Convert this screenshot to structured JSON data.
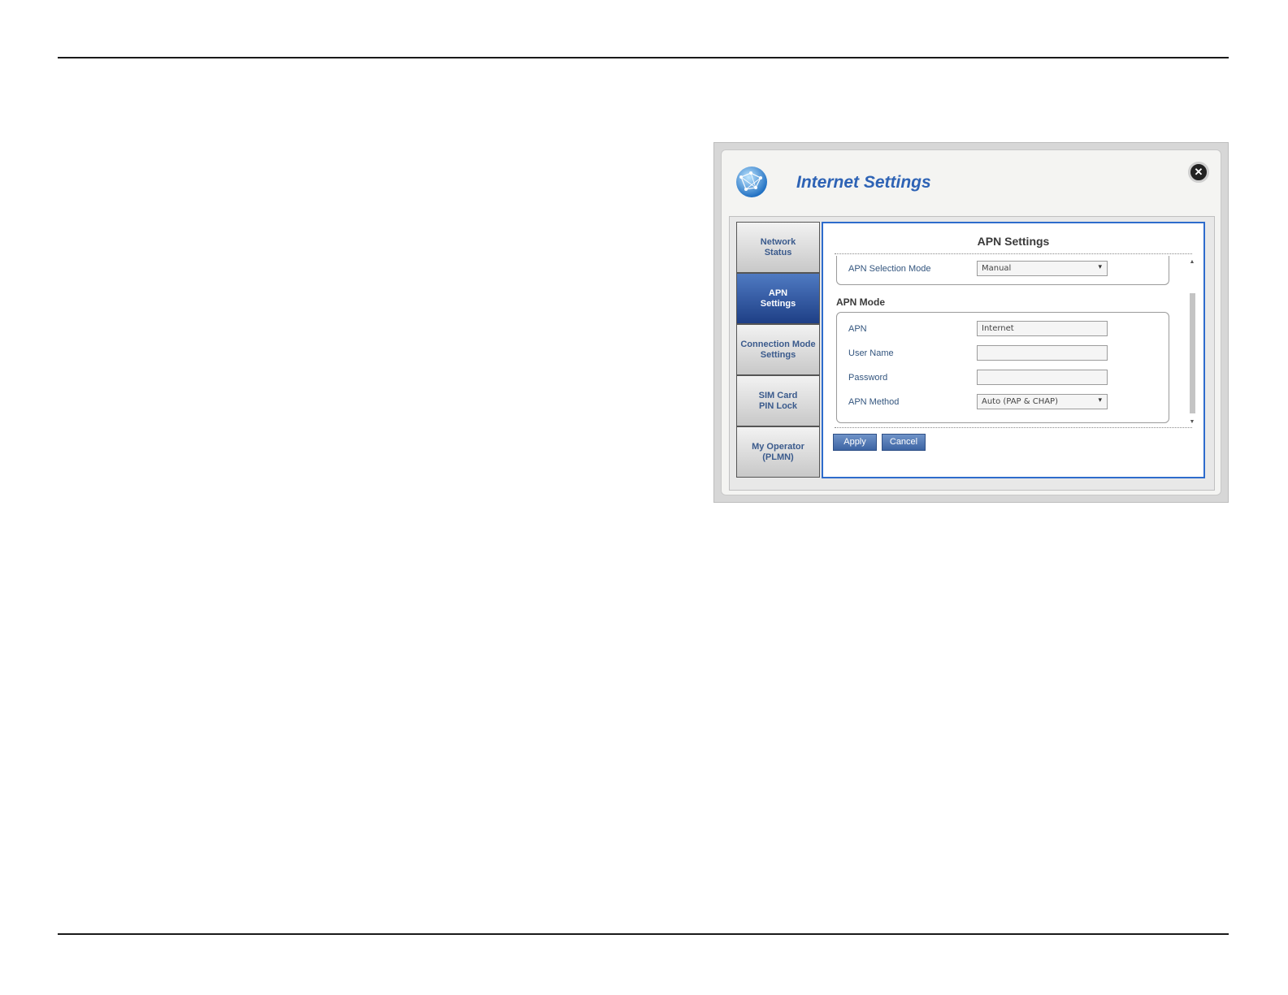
{
  "window": {
    "title": "Internet Settings"
  },
  "sidebar": {
    "items": [
      {
        "label": "Network\nStatus",
        "active": false
      },
      {
        "label": "APN\nSettings",
        "active": true
      },
      {
        "label": "Connection Mode\nSettings",
        "active": false
      },
      {
        "label": "SIM Card\nPIN Lock",
        "active": false
      },
      {
        "label": "My Operator\n(PLMN)",
        "active": false
      }
    ]
  },
  "panel": {
    "title": "APN Settings",
    "apn_selection_mode": {
      "label": "APN Selection Mode",
      "value": "Manual"
    },
    "apn_mode_heading": "APN Mode",
    "apn": {
      "label": "APN",
      "value": "Internet"
    },
    "username": {
      "label": "User Name",
      "value": ""
    },
    "password": {
      "label": "Password",
      "value": ""
    },
    "apn_method": {
      "label": "APN Method",
      "value": "Auto (PAP & CHAP)"
    },
    "apply_label": "Apply",
    "cancel_label": "Cancel"
  },
  "icons": {
    "close": "close-icon",
    "globe": "globe-icon"
  },
  "colors": {
    "accent": "#2e63b5",
    "active_tab": "#1e3f86",
    "panel_border": "#2e6ccc"
  }
}
